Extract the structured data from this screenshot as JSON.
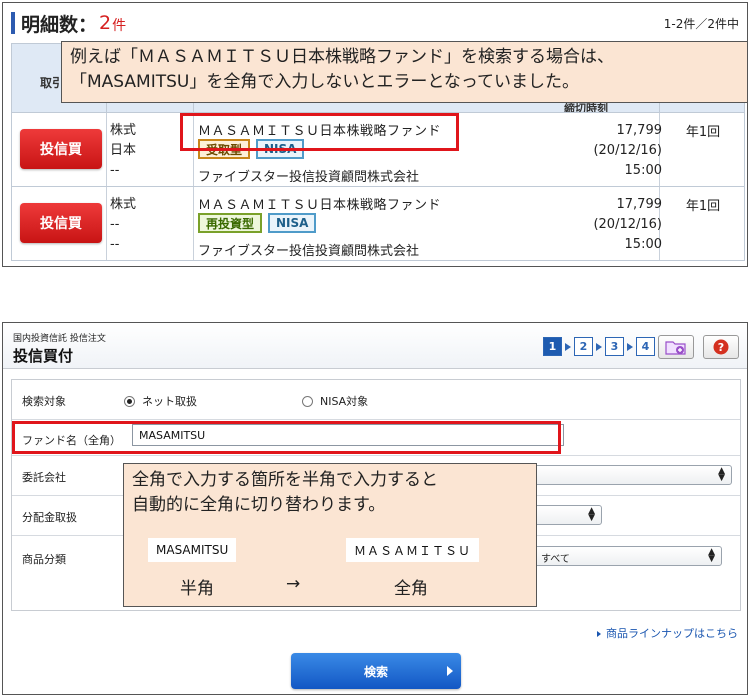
{
  "top": {
    "count_label": "明細数：",
    "count_value": "2",
    "count_unit": "件",
    "range": "1-2件／2件中",
    "th_first": "取引",
    "th_date": "締切時刻",
    "rows": [
      {
        "button": "投信買",
        "category": [
          "株式",
          "日本",
          "--"
        ],
        "fund": "ＭＡＳＡＭＩＴＳＵ日本株戦略ファンド",
        "badge_type": "受取型",
        "badge_nisa": "NISA",
        "company": "ファイブスター投信投資顧問株式会社",
        "price": "17,799",
        "date": "(20/12/16)",
        "time": "15:00",
        "freq": "年1回"
      },
      {
        "button": "投信買",
        "category": [
          "株式",
          "--",
          "--"
        ],
        "fund": "ＭＡＳＡＭＩＴＳＵ日本株戦略ファンド",
        "badge_type": "再投資型",
        "badge_nisa": "NISA",
        "company": "ファイブスター投信投資顧問株式会社",
        "price": "17,799",
        "date": "(20/12/16)",
        "time": "15:00",
        "freq": "年1回"
      }
    ],
    "callout": {
      "line1": "例えば「ＭＡＳＡＭＩＴＳＵ日本株戦略ファンド」を検索する場合は、",
      "line2": "「MASAMITSU」を全角で入力しないとエラーとなっていました。"
    }
  },
  "bottom": {
    "breadcrumb": "国内投資信託 投信注文",
    "title": "投信買付",
    "steps": [
      "1",
      "2",
      "3",
      "4"
    ],
    "form": {
      "target_label": "検索対象",
      "radio_net": "ネット取扱",
      "radio_nisa": "NISA対象",
      "fund_label": "ファンド名（全角）",
      "fund_value": "MASAMITSU",
      "company_label": "委託会社",
      "dist_label": "分配金取扱",
      "product_label": "商品分類",
      "product_value": "すべて"
    },
    "callout": {
      "line1": "全角で入力する箇所を半角で入力すると",
      "line2": "自動的に全角に切り替わります。",
      "half_example": "MASAMITSU",
      "full_example": "ＭＡＳＡＭＩＴＳＵ",
      "half_label": "半角",
      "arrow": "→",
      "full_label": "全角"
    },
    "lineup_link": "商品ラインナップはこちら",
    "search_button": "検索"
  },
  "colors": {
    "red": "#e0151b",
    "blue": "#1e5bb0",
    "callout": "#fbe5d3"
  }
}
